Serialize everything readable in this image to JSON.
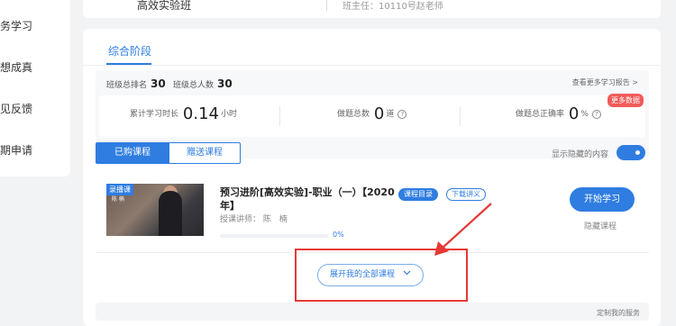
{
  "sidebar": {
    "items": [
      {
        "label": "务学习"
      },
      {
        "label": "想成真"
      },
      {
        "label": "见反馈"
      },
      {
        "label": "期申请"
      }
    ]
  },
  "top": {
    "class_name": "高效实验班",
    "teacher": "班主任：10110号赵老师"
  },
  "stage": {
    "tab": "综合阶段"
  },
  "stats": {
    "class_rank_label": "班级总排名",
    "class_rank_value": "30",
    "class_total_label": "班级总人数",
    "class_total_value": "30",
    "report_link": "查看更多学习报告 >",
    "duration_label": "累计学习时长",
    "duration_value": "0.14",
    "duration_unit": "小时",
    "questions_label": "做题总数",
    "questions_value": "0",
    "questions_unit": "道",
    "accuracy_label": "做题总正确率",
    "accuracy_value": "0",
    "accuracy_unit": "%",
    "more_badge": "更多数据"
  },
  "tabs": {
    "purchased": "已购课程",
    "gifted": "赠送课程",
    "show_hidden": "显示隐藏的内容"
  },
  "course": {
    "thumb_tag": "录播课",
    "thumb_caption": "陈 楠",
    "title": "预习进阶[高效实验]-职业（一）【2020年】",
    "catalog": "课程目录",
    "download": "下载讲义",
    "lecturer": "授课讲师： 陈　楠",
    "progress": 0,
    "progress_label": "0%",
    "start": "开始学习",
    "hide": "隐藏课程"
  },
  "expand": {
    "label": "展开我的全部课程"
  },
  "bottom": {
    "text": "定制我的服务"
  },
  "colors": {
    "accent": "#2f7de1",
    "annotation_red": "#e53935",
    "badge_red": "#f25b5b"
  }
}
